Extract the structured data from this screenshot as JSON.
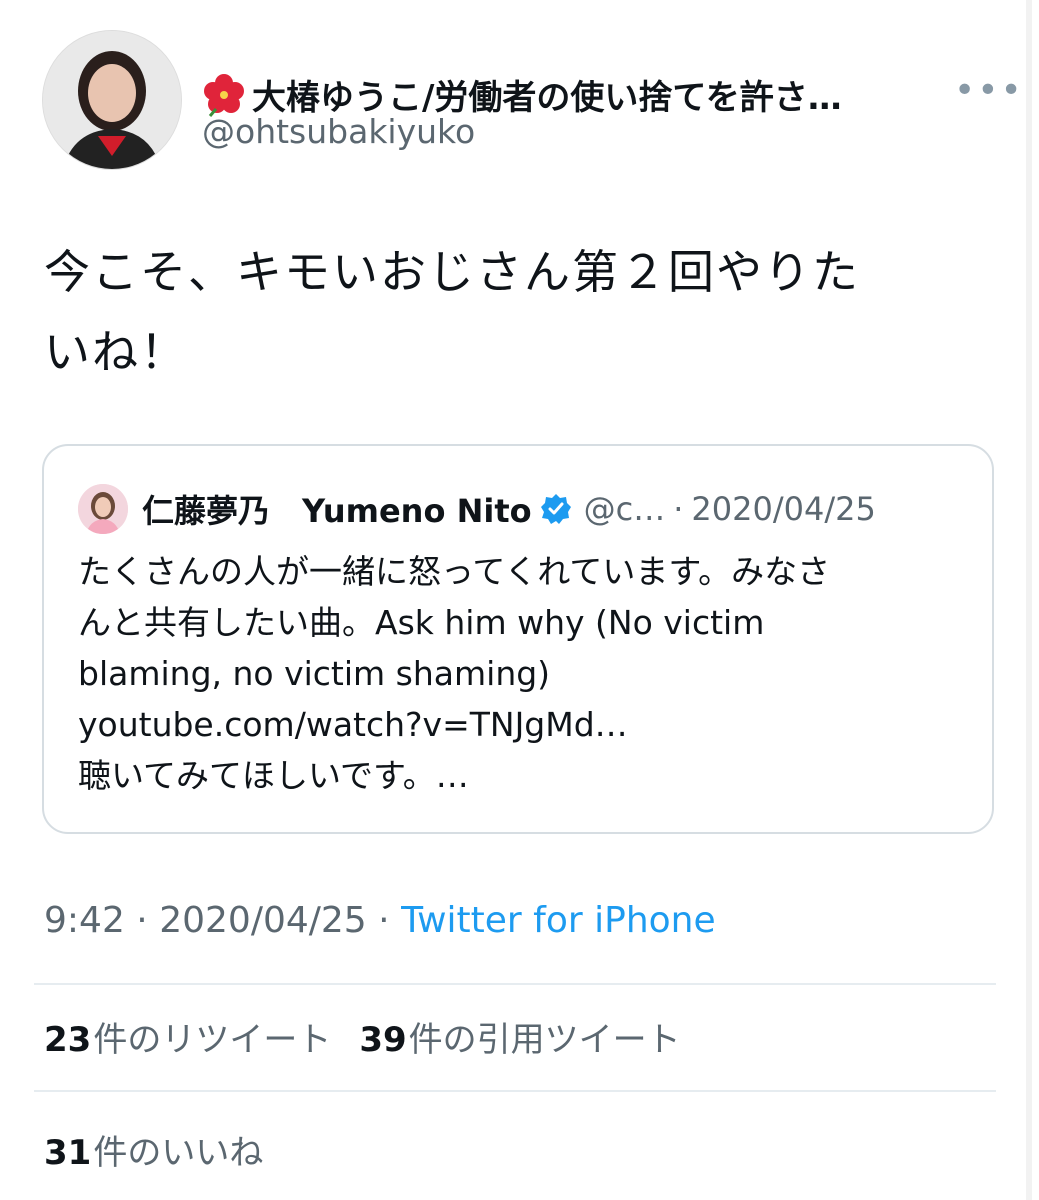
{
  "tweet": {
    "display_name": "大椿ゆうこ/労働者の使い捨てを許さ…",
    "handle": "@ohtsubakiyuko",
    "flower_icon": "hibiscus-icon",
    "avatar_icon": "profile-photo",
    "more_icon": "more-dots-icon",
    "text_line1": "今こそ、キモいおじさん第２回やりた",
    "text_line2": "いね！"
  },
  "quoted_tweet": {
    "avatar_icon": "profile-photo",
    "name": "仁藤夢乃　Yumeno Nito",
    "verified_icon": "verified-badge-icon",
    "handle": "@c…",
    "separator": "·",
    "date": "2020/04/25",
    "lines": [
      "たくさんの人が一緒に怒ってくれています。みなさ",
      "んと共有したい曲。Ask him why (No victim",
      "blaming, no victim shaming)",
      "youtube.com/watch?v=TNJgMd…",
      "聴いてみてほしいです。…"
    ]
  },
  "meta": {
    "time": "9:42",
    "separator": "·",
    "date": "2020/04/25",
    "source": "Twitter for iPhone"
  },
  "stats": {
    "retweets_count": "23",
    "retweets_label": "件のリツイート",
    "quotes_count": "39",
    "quotes_label": "件の引用ツイート",
    "likes_count": "31",
    "likes_label": "件のいいね"
  },
  "colors": {
    "link": "#1d9bf0",
    "verified": "#1d9bf0",
    "secondary_text": "#5b6770"
  }
}
